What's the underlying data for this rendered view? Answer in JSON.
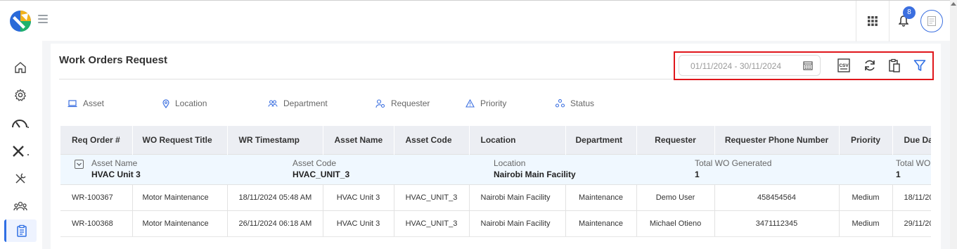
{
  "header": {
    "notifications_count": "8"
  },
  "sidebar": {
    "items": [
      "home-icon",
      "gear-icon",
      "gauge-icon",
      "tools-icon",
      "wrench-screwdriver-icon",
      "team-icon",
      "clipboard-icon"
    ]
  },
  "page": {
    "title": "Work Orders Request"
  },
  "toolbar": {
    "date_range_placeholder": "01/11/2024 - 30/11/2024",
    "csv_label": "CSV"
  },
  "filters": [
    {
      "label": "Asset",
      "icon": "laptop-icon"
    },
    {
      "label": "Location",
      "icon": "location-pin-icon"
    },
    {
      "label": "Department",
      "icon": "people-icon"
    },
    {
      "label": "Requester",
      "icon": "user-gear-icon"
    },
    {
      "label": "Priority",
      "icon": "warning-triangle-icon"
    },
    {
      "label": "Status",
      "icon": "nodes-icon"
    }
  ],
  "table": {
    "columns": [
      "Req Order #",
      "WO Request Title",
      "WR Timestamp",
      "Asset Name",
      "Asset Code",
      "Location",
      "Department",
      "Requester",
      "Requester Phone Number",
      "Priority",
      "Due Da"
    ],
    "group": {
      "asset_name_label": "Asset Name",
      "asset_name": "HVAC Unit 3",
      "asset_code_label": "Asset Code",
      "asset_code": "HVAC_UNIT_3",
      "location_label": "Location",
      "location": "Nairobi Main Facility",
      "total_label": "Total WO Generated",
      "total": "1",
      "total2_label": "Total WO",
      "total2": "1"
    },
    "rows": [
      [
        "WR-100367",
        "Motor Maintenance",
        "18/11/2024 05:48 AM",
        "HVAC Unit 3",
        "HVAC_UNIT_3",
        "Nairobi Main Facility",
        "Maintenance",
        "Demo User",
        "458454564",
        "Medium",
        "18/11/20"
      ],
      [
        "WR-100368",
        "Motor Maintenance",
        "26/11/2024 06:18 AM",
        "HVAC Unit 3",
        "HVAC_UNIT_3",
        "Nairobi Main Facility",
        "Maintenance",
        "Michael Otieno",
        "3471112345",
        "Medium",
        "29/11/20"
      ]
    ]
  },
  "colors": {
    "accent": "#2f6fe4",
    "highlight_border": "#e0161b",
    "group_bg": "#f0f8ff",
    "header_bg": "#eceef3"
  }
}
